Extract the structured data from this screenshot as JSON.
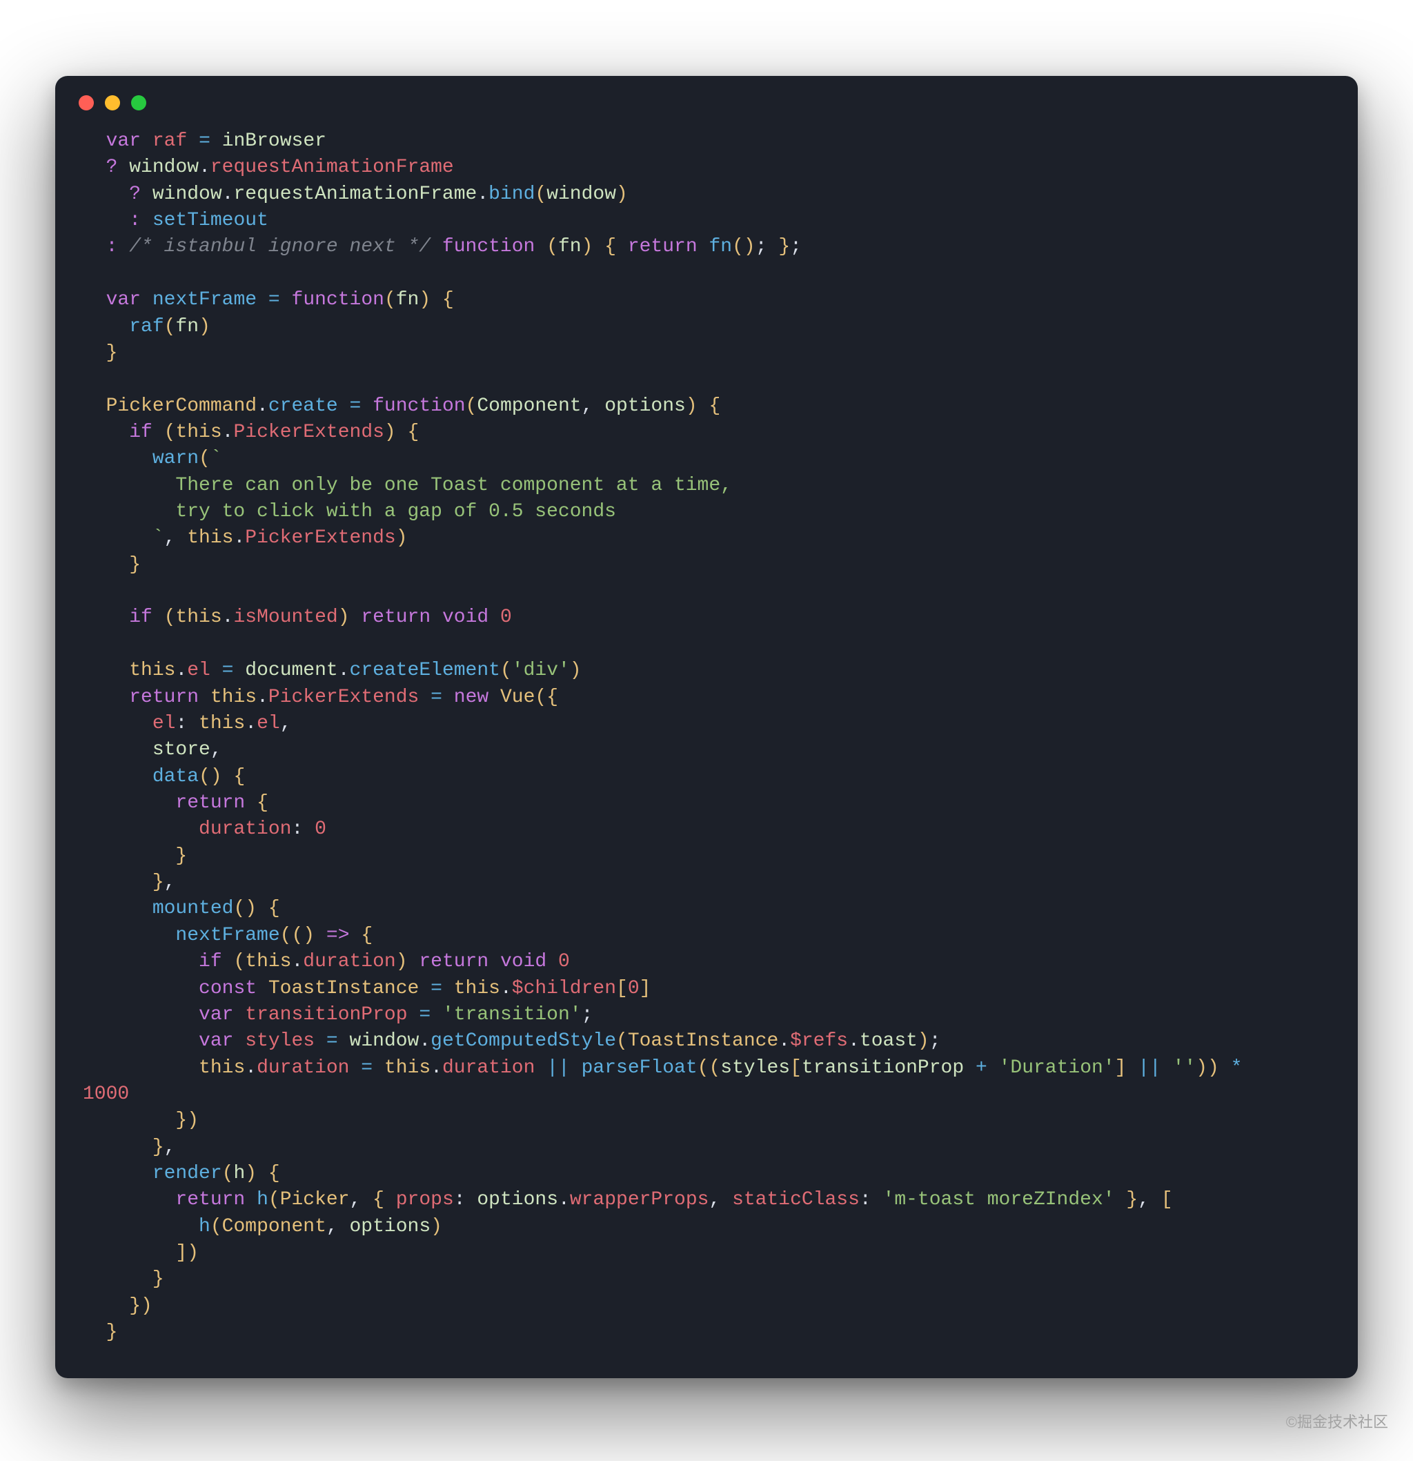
{
  "watermark": "©掘金技术社区",
  "code": {
    "lines": [
      [
        {
          "t": "  "
        },
        {
          "t": "var",
          "c": "kw"
        },
        {
          "t": " "
        },
        {
          "t": "raf",
          "c": "pr"
        },
        {
          "t": " "
        },
        {
          "t": "=",
          "c": "fn"
        },
        {
          "t": " "
        },
        {
          "t": "inBrowser",
          "c": "id"
        }
      ],
      [
        {
          "t": "  "
        },
        {
          "t": "?",
          "c": "kw"
        },
        {
          "t": " "
        },
        {
          "t": "window",
          "c": "id"
        },
        {
          "t": "."
        },
        {
          "t": "requestAnimationFrame",
          "c": "pr"
        }
      ],
      [
        {
          "t": "    "
        },
        {
          "t": "?",
          "c": "kw"
        },
        {
          "t": " "
        },
        {
          "t": "window",
          "c": "id"
        },
        {
          "t": "."
        },
        {
          "t": "requestAnimationFrame",
          "c": "id"
        },
        {
          "t": "."
        },
        {
          "t": "bind",
          "c": "fn"
        },
        {
          "t": "(",
          "c": "pn"
        },
        {
          "t": "window",
          "c": "id"
        },
        {
          "t": ")",
          "c": "pn"
        }
      ],
      [
        {
          "t": "    "
        },
        {
          "t": ":",
          "c": "kw"
        },
        {
          "t": " "
        },
        {
          "t": "setTimeout",
          "c": "fn"
        }
      ],
      [
        {
          "t": "  "
        },
        {
          "t": ":",
          "c": "kw"
        },
        {
          "t": " "
        },
        {
          "t": "/* istanbul ignore next */",
          "c": "cm"
        },
        {
          "t": " "
        },
        {
          "t": "function",
          "c": "kw"
        },
        {
          "t": " "
        },
        {
          "t": "(",
          "c": "pn"
        },
        {
          "t": "fn",
          "c": "id"
        },
        {
          "t": ")",
          "c": "pn"
        },
        {
          "t": " "
        },
        {
          "t": "{",
          "c": "pn"
        },
        {
          "t": " "
        },
        {
          "t": "return",
          "c": "kw"
        },
        {
          "t": " "
        },
        {
          "t": "fn",
          "c": "fn"
        },
        {
          "t": "(",
          "c": "pn"
        },
        {
          "t": ")",
          "c": "pn"
        },
        {
          "t": "; "
        },
        {
          "t": "}",
          "c": "pn"
        },
        {
          "t": ";"
        }
      ],
      [],
      [
        {
          "t": "  "
        },
        {
          "t": "var",
          "c": "kw"
        },
        {
          "t": " "
        },
        {
          "t": "nextFrame",
          "c": "fn"
        },
        {
          "t": " "
        },
        {
          "t": "=",
          "c": "fn"
        },
        {
          "t": " "
        },
        {
          "t": "function",
          "c": "kw"
        },
        {
          "t": "(",
          "c": "pn"
        },
        {
          "t": "fn",
          "c": "id"
        },
        {
          "t": ")",
          "c": "pn"
        },
        {
          "t": " "
        },
        {
          "t": "{",
          "c": "pn"
        }
      ],
      [
        {
          "t": "    "
        },
        {
          "t": "raf",
          "c": "fn"
        },
        {
          "t": "(",
          "c": "pn"
        },
        {
          "t": "fn",
          "c": "id"
        },
        {
          "t": ")",
          "c": "pn"
        }
      ],
      [
        {
          "t": "  "
        },
        {
          "t": "}",
          "c": "pn"
        }
      ],
      [],
      [
        {
          "t": "  "
        },
        {
          "t": "PickerCommand",
          "c": "vd"
        },
        {
          "t": "."
        },
        {
          "t": "create",
          "c": "fn"
        },
        {
          "t": " "
        },
        {
          "t": "=",
          "c": "fn"
        },
        {
          "t": " "
        },
        {
          "t": "function",
          "c": "kw"
        },
        {
          "t": "(",
          "c": "pn"
        },
        {
          "t": "Component",
          "c": "id"
        },
        {
          "t": ", "
        },
        {
          "t": "options",
          "c": "id"
        },
        {
          "t": ")",
          "c": "pn"
        },
        {
          "t": " "
        },
        {
          "t": "{",
          "c": "pn"
        }
      ],
      [
        {
          "t": "    "
        },
        {
          "t": "if",
          "c": "kw"
        },
        {
          "t": " "
        },
        {
          "t": "(",
          "c": "pn"
        },
        {
          "t": "this",
          "c": "th"
        },
        {
          "t": "."
        },
        {
          "t": "PickerExtends",
          "c": "pr"
        },
        {
          "t": ")",
          "c": "pn"
        },
        {
          "t": " "
        },
        {
          "t": "{",
          "c": "pn"
        }
      ],
      [
        {
          "t": "      "
        },
        {
          "t": "warn",
          "c": "fn"
        },
        {
          "t": "(",
          "c": "pn"
        },
        {
          "t": "`",
          "c": "st"
        }
      ],
      [
        {
          "t": "        There can only be one Toast component at a time,",
          "c": "st"
        }
      ],
      [
        {
          "t": "        try to click with a gap of 0.5 seconds",
          "c": "st"
        }
      ],
      [
        {
          "t": "      `",
          "c": "st"
        },
        {
          "t": ", "
        },
        {
          "t": "this",
          "c": "th"
        },
        {
          "t": "."
        },
        {
          "t": "PickerExtends",
          "c": "pr"
        },
        {
          "t": ")",
          "c": "pn"
        }
      ],
      [
        {
          "t": "    "
        },
        {
          "t": "}",
          "c": "pn"
        }
      ],
      [],
      [
        {
          "t": "    "
        },
        {
          "t": "if",
          "c": "kw"
        },
        {
          "t": " "
        },
        {
          "t": "(",
          "c": "pn"
        },
        {
          "t": "this",
          "c": "th"
        },
        {
          "t": "."
        },
        {
          "t": "isMounted",
          "c": "pr"
        },
        {
          "t": ")",
          "c": "pn"
        },
        {
          "t": " "
        },
        {
          "t": "return",
          "c": "kw"
        },
        {
          "t": " "
        },
        {
          "t": "void",
          "c": "kw"
        },
        {
          "t": " "
        },
        {
          "t": "0",
          "c": "nm"
        }
      ],
      [],
      [
        {
          "t": "    "
        },
        {
          "t": "this",
          "c": "th"
        },
        {
          "t": "."
        },
        {
          "t": "el",
          "c": "pr"
        },
        {
          "t": " "
        },
        {
          "t": "=",
          "c": "fn"
        },
        {
          "t": " "
        },
        {
          "t": "document",
          "c": "id"
        },
        {
          "t": "."
        },
        {
          "t": "createElement",
          "c": "fn"
        },
        {
          "t": "(",
          "c": "pn"
        },
        {
          "t": "'div'",
          "c": "st"
        },
        {
          "t": ")",
          "c": "pn"
        }
      ],
      [
        {
          "t": "    "
        },
        {
          "t": "return",
          "c": "kw"
        },
        {
          "t": " "
        },
        {
          "t": "this",
          "c": "th"
        },
        {
          "t": "."
        },
        {
          "t": "PickerExtends",
          "c": "pr"
        },
        {
          "t": " "
        },
        {
          "t": "=",
          "c": "fn"
        },
        {
          "t": " "
        },
        {
          "t": "new",
          "c": "kw"
        },
        {
          "t": " "
        },
        {
          "t": "Vue",
          "c": "vd"
        },
        {
          "t": "(",
          "c": "pn"
        },
        {
          "t": "{",
          "c": "pn"
        }
      ],
      [
        {
          "t": "      "
        },
        {
          "t": "el",
          "c": "pr"
        },
        {
          "t": ": "
        },
        {
          "t": "this",
          "c": "th"
        },
        {
          "t": "."
        },
        {
          "t": "el",
          "c": "pr"
        },
        {
          "t": ","
        }
      ],
      [
        {
          "t": "      "
        },
        {
          "t": "store",
          "c": "id"
        },
        {
          "t": ","
        }
      ],
      [
        {
          "t": "      "
        },
        {
          "t": "data",
          "c": "fn"
        },
        {
          "t": "(",
          "c": "pn"
        },
        {
          "t": ")",
          "c": "pn"
        },
        {
          "t": " "
        },
        {
          "t": "{",
          "c": "pn"
        }
      ],
      [
        {
          "t": "        "
        },
        {
          "t": "return",
          "c": "kw"
        },
        {
          "t": " "
        },
        {
          "t": "{",
          "c": "pn"
        }
      ],
      [
        {
          "t": "          "
        },
        {
          "t": "duration",
          "c": "pr"
        },
        {
          "t": ": "
        },
        {
          "t": "0",
          "c": "nm"
        }
      ],
      [
        {
          "t": "        "
        },
        {
          "t": "}",
          "c": "pn"
        }
      ],
      [
        {
          "t": "      "
        },
        {
          "t": "}",
          "c": "pn"
        },
        {
          "t": ","
        }
      ],
      [
        {
          "t": "      "
        },
        {
          "t": "mounted",
          "c": "fn"
        },
        {
          "t": "(",
          "c": "pn"
        },
        {
          "t": ")",
          "c": "pn"
        },
        {
          "t": " "
        },
        {
          "t": "{",
          "c": "pn"
        }
      ],
      [
        {
          "t": "        "
        },
        {
          "t": "nextFrame",
          "c": "fn"
        },
        {
          "t": "(",
          "c": "pn"
        },
        {
          "t": "(",
          "c": "pn"
        },
        {
          "t": ")",
          "c": "pn"
        },
        {
          "t": " "
        },
        {
          "t": "=>",
          "c": "kw"
        },
        {
          "t": " "
        },
        {
          "t": "{",
          "c": "pn"
        }
      ],
      [
        {
          "t": "          "
        },
        {
          "t": "if",
          "c": "kw"
        },
        {
          "t": " "
        },
        {
          "t": "(",
          "c": "pn"
        },
        {
          "t": "this",
          "c": "th"
        },
        {
          "t": "."
        },
        {
          "t": "duration",
          "c": "pr"
        },
        {
          "t": ")",
          "c": "pn"
        },
        {
          "t": " "
        },
        {
          "t": "return",
          "c": "kw"
        },
        {
          "t": " "
        },
        {
          "t": "void",
          "c": "kw"
        },
        {
          "t": " "
        },
        {
          "t": "0",
          "c": "nm"
        }
      ],
      [
        {
          "t": "          "
        },
        {
          "t": "const",
          "c": "kw"
        },
        {
          "t": " "
        },
        {
          "t": "ToastInstance",
          "c": "vd"
        },
        {
          "t": " "
        },
        {
          "t": "=",
          "c": "fn"
        },
        {
          "t": " "
        },
        {
          "t": "this",
          "c": "th"
        },
        {
          "t": "."
        },
        {
          "t": "$children",
          "c": "pr"
        },
        {
          "t": "[",
          "c": "pn"
        },
        {
          "t": "0",
          "c": "nm"
        },
        {
          "t": "]",
          "c": "pn"
        }
      ],
      [
        {
          "t": "          "
        },
        {
          "t": "var",
          "c": "kw"
        },
        {
          "t": " "
        },
        {
          "t": "transitionProp",
          "c": "pr"
        },
        {
          "t": " "
        },
        {
          "t": "=",
          "c": "fn"
        },
        {
          "t": " "
        },
        {
          "t": "'transition'",
          "c": "st"
        },
        {
          "t": ";"
        }
      ],
      [
        {
          "t": "          "
        },
        {
          "t": "var",
          "c": "kw"
        },
        {
          "t": " "
        },
        {
          "t": "styles",
          "c": "pr"
        },
        {
          "t": " "
        },
        {
          "t": "=",
          "c": "fn"
        },
        {
          "t": " "
        },
        {
          "t": "window",
          "c": "id"
        },
        {
          "t": "."
        },
        {
          "t": "getComputedStyle",
          "c": "fn"
        },
        {
          "t": "(",
          "c": "pn"
        },
        {
          "t": "ToastInstance",
          "c": "vd"
        },
        {
          "t": "."
        },
        {
          "t": "$refs",
          "c": "pr"
        },
        {
          "t": "."
        },
        {
          "t": "toast",
          "c": "id"
        },
        {
          "t": ")",
          "c": "pn"
        },
        {
          "t": ";"
        }
      ],
      [
        {
          "t": "          "
        },
        {
          "t": "this",
          "c": "th"
        },
        {
          "t": "."
        },
        {
          "t": "duration",
          "c": "pr"
        },
        {
          "t": " "
        },
        {
          "t": "=",
          "c": "fn"
        },
        {
          "t": " "
        },
        {
          "t": "this",
          "c": "th"
        },
        {
          "t": "."
        },
        {
          "t": "duration",
          "c": "pr"
        },
        {
          "t": " "
        },
        {
          "t": "||",
          "c": "fn"
        },
        {
          "t": " "
        },
        {
          "t": "parseFloat",
          "c": "fn"
        },
        {
          "t": "(",
          "c": "pn"
        },
        {
          "t": "(",
          "c": "pn"
        },
        {
          "t": "styles",
          "c": "id"
        },
        {
          "t": "[",
          "c": "pn"
        },
        {
          "t": "transitionProp",
          "c": "id"
        },
        {
          "t": " "
        },
        {
          "t": "+",
          "c": "fn"
        },
        {
          "t": " "
        },
        {
          "t": "'Duration'",
          "c": "st"
        },
        {
          "t": "]",
          "c": "pn"
        },
        {
          "t": " "
        },
        {
          "t": "||",
          "c": "fn"
        },
        {
          "t": " "
        },
        {
          "t": "''",
          "c": "st"
        },
        {
          "t": ")",
          "c": "pn"
        },
        {
          "t": ")",
          "c": "pn"
        },
        {
          "t": " "
        },
        {
          "t": "*",
          "c": "fn"
        },
        {
          "t": " "
        }
      ],
      [
        {
          "t": "1000",
          "c": "nm"
        }
      ],
      [
        {
          "t": "        "
        },
        {
          "t": "}",
          "c": "pn"
        },
        {
          "t": ")",
          "c": "pn"
        }
      ],
      [
        {
          "t": "      "
        },
        {
          "t": "}",
          "c": "pn"
        },
        {
          "t": ","
        }
      ],
      [
        {
          "t": "      "
        },
        {
          "t": "render",
          "c": "fn"
        },
        {
          "t": "(",
          "c": "pn"
        },
        {
          "t": "h",
          "c": "id"
        },
        {
          "t": ")",
          "c": "pn"
        },
        {
          "t": " "
        },
        {
          "t": "{",
          "c": "pn"
        }
      ],
      [
        {
          "t": "        "
        },
        {
          "t": "return",
          "c": "kw"
        },
        {
          "t": " "
        },
        {
          "t": "h",
          "c": "fn"
        },
        {
          "t": "(",
          "c": "pn"
        },
        {
          "t": "Picker",
          "c": "vd"
        },
        {
          "t": ", "
        },
        {
          "t": "{",
          "c": "pn"
        },
        {
          "t": " "
        },
        {
          "t": "props",
          "c": "pr"
        },
        {
          "t": ": "
        },
        {
          "t": "options",
          "c": "id"
        },
        {
          "t": "."
        },
        {
          "t": "wrapperProps",
          "c": "pr"
        },
        {
          "t": ", "
        },
        {
          "t": "staticClass",
          "c": "pr"
        },
        {
          "t": ": "
        },
        {
          "t": "'m-toast moreZIndex'",
          "c": "st"
        },
        {
          "t": " "
        },
        {
          "t": "}",
          "c": "pn"
        },
        {
          "t": ", "
        },
        {
          "t": "[",
          "c": "pn"
        }
      ],
      [
        {
          "t": "          "
        },
        {
          "t": "h",
          "c": "fn"
        },
        {
          "t": "(",
          "c": "pn"
        },
        {
          "t": "Component",
          "c": "vd"
        },
        {
          "t": ", "
        },
        {
          "t": "options",
          "c": "id"
        },
        {
          "t": ")",
          "c": "pn"
        }
      ],
      [
        {
          "t": "        "
        },
        {
          "t": "]",
          "c": "pn"
        },
        {
          "t": ")",
          "c": "pn"
        }
      ],
      [
        {
          "t": "      "
        },
        {
          "t": "}",
          "c": "pn"
        }
      ],
      [
        {
          "t": "    "
        },
        {
          "t": "}",
          "c": "pn"
        },
        {
          "t": ")",
          "c": "pn"
        }
      ],
      [
        {
          "t": "  "
        },
        {
          "t": "}",
          "c": "pn"
        }
      ]
    ]
  }
}
